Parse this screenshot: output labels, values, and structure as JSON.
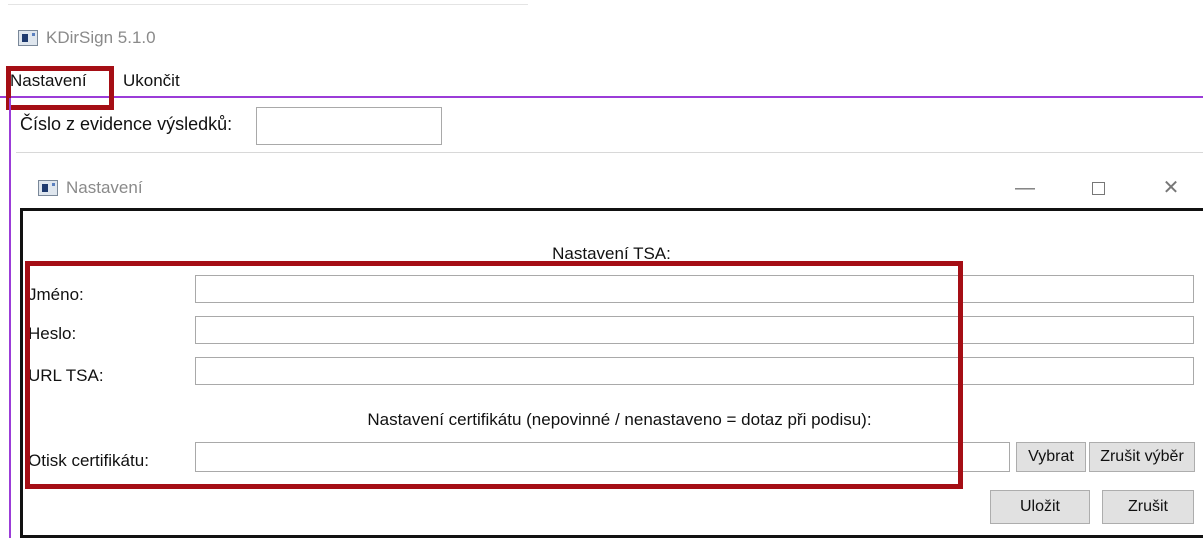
{
  "main_window": {
    "title": "KDirSign 5.1.0",
    "menu": [
      {
        "label": "Nastavení"
      },
      {
        "label": "Ukončit"
      }
    ],
    "evidence": {
      "label": "Číslo z evidence výsledků:",
      "value": ""
    }
  },
  "dialog": {
    "title": "Nastavení",
    "tsa_heading": "Nastavení TSA:",
    "fields": {
      "jmeno": {
        "label": "Jméno:",
        "value": ""
      },
      "heslo": {
        "label": "Heslo:",
        "value": ""
      },
      "url_tsa": {
        "label": "URL TSA:",
        "value": ""
      }
    },
    "cert_heading": "Nastavení certifikátu (nepovinné / nenastaveno = dotaz při podisu):",
    "cert": {
      "label": "Otisk certifikátu:",
      "value": ""
    },
    "buttons": {
      "vybrat": "Vybrat",
      "zrusit_vyber": "Zrušit výběr",
      "ulozit": "Uložit",
      "zrusit": "Zrušit"
    },
    "window_controls": {
      "minimize": "—",
      "close": "✕"
    }
  },
  "icons": {
    "app": "app-window-icon",
    "minimize": "minimize-icon",
    "maximize": "maximize-icon",
    "close": "close-icon"
  },
  "colors": {
    "highlight_box": "#a50e15",
    "menubar_accent": "#9b3cd8",
    "dialog_border": "#111111"
  }
}
